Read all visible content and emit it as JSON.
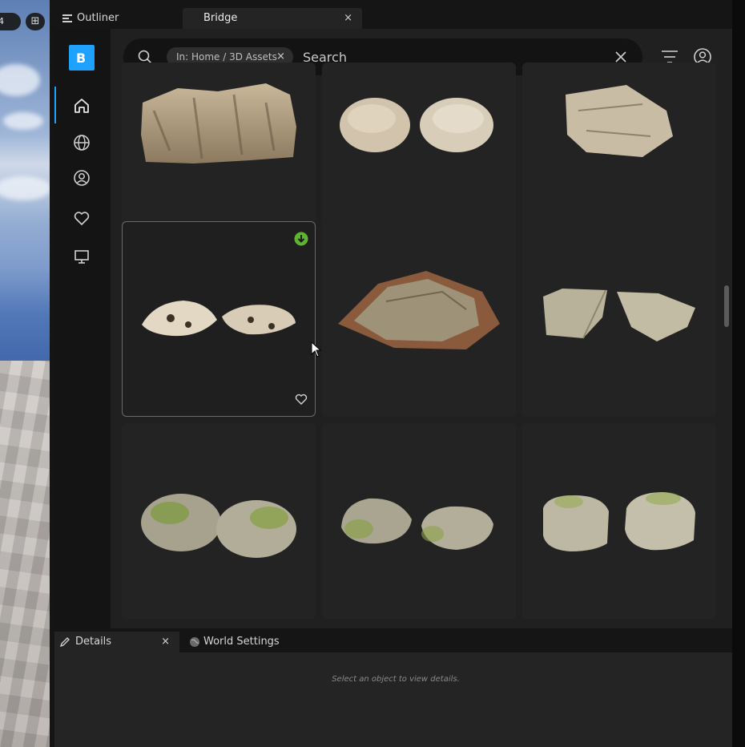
{
  "viewport": {
    "camera_speed": "4",
    "layout_icon": "grid-icon"
  },
  "tabs": {
    "outliner": "Outliner",
    "bridge": "Bridge",
    "close": "×"
  },
  "bridge": {
    "logo_letter": "B",
    "nav": [
      {
        "name": "home-icon",
        "active": true
      },
      {
        "name": "globe-icon",
        "active": false
      },
      {
        "name": "user-icon",
        "active": false
      },
      {
        "name": "heart-icon",
        "active": false
      },
      {
        "name": "monitor-icon",
        "active": false
      }
    ],
    "search": {
      "chip_label": "In: Home / 3D Assets",
      "chip_close": "×",
      "placeholder": "Search"
    },
    "assets": [
      {
        "row": 0,
        "col": 0,
        "icon": "rock-cliff"
      },
      {
        "row": 0,
        "col": 1,
        "icon": "rocks-pair-sandstone"
      },
      {
        "row": 0,
        "col": 2,
        "icon": "rock-boulder-cracked"
      },
      {
        "row": 1,
        "col": 0,
        "icon": "rocks-pair-flat",
        "selected": true,
        "downloaded": true
      },
      {
        "row": 1,
        "col": 1,
        "icon": "rock-slab-mossy"
      },
      {
        "row": 1,
        "col": 2,
        "icon": "rocks-pair-angular"
      },
      {
        "row": 2,
        "col": 0,
        "icon": "rocks-pair-mossy-round"
      },
      {
        "row": 2,
        "col": 1,
        "icon": "rocks-pair-mossy-oblong"
      },
      {
        "row": 2,
        "col": 2,
        "icon": "rocks-pair-mossy-cube"
      }
    ],
    "colors": {
      "accent": "#1ea1ff",
      "download": "#5fb32f"
    }
  },
  "details": {
    "tab_details": "Details",
    "tab_world_settings": "World Settings",
    "close": "×",
    "hint": "Select an object to view details."
  }
}
